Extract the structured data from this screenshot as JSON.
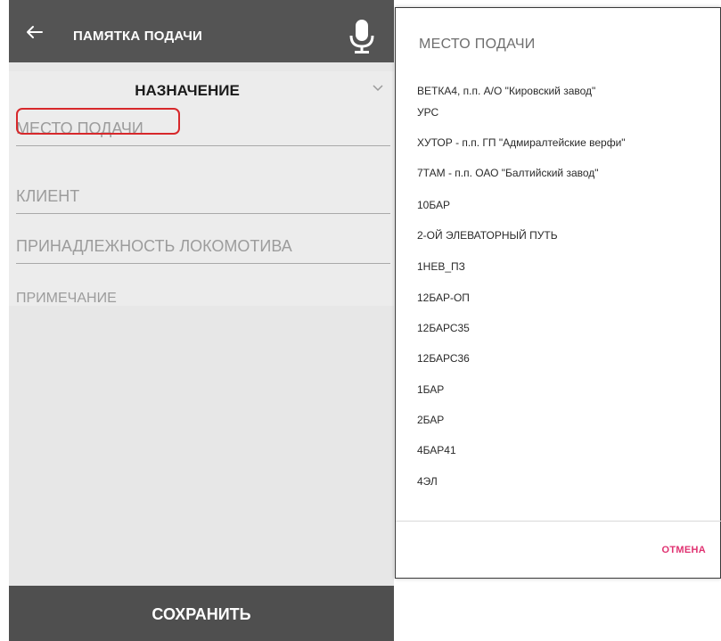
{
  "appbar": {
    "title": "ПАМЯТКА ПОДАЧИ",
    "back_icon": "arrow-left-icon",
    "mic_icon": "microphone-icon"
  },
  "form": {
    "spinner_value": "НАЗНАЧЕНИЕ",
    "fields": [
      {
        "placeholder": "МЕСТО ПОДАЧИ"
      },
      {
        "placeholder": "КЛИЕНТ"
      },
      {
        "placeholder": "ПРИНАДЛЕЖНОСТЬ ЛОКОМОТИВА"
      },
      {
        "placeholder": "ПРИМЕЧАНИЕ"
      }
    ],
    "highlight_color": "#d7282b"
  },
  "save_label": "СОХРАНИТЬ",
  "dialog": {
    "title": "МЕСТО ПОДАЧИ",
    "options": [
      "ВЕТКА4, п.п. А/О \"Кировский завод\"",
      "УРС",
      "ХУТОР - п.п. ГП \"Адмиралтейские верфи\"",
      "7ТАМ - п.п. ОАО \"Балтийский завод\"",
      "10БАР",
      "2-ОЙ ЭЛЕВАТОРНЫЙ ПУТЬ",
      "1НЕВ_ПЗ",
      "12БАР-ОП",
      "12БАРС35",
      "12БАРС36",
      "1БАР",
      "2БАР",
      "4БАР41",
      "4ЭЛ"
    ],
    "cancel_label": "ОТМЕНА",
    "accent_color": "#e03271"
  }
}
